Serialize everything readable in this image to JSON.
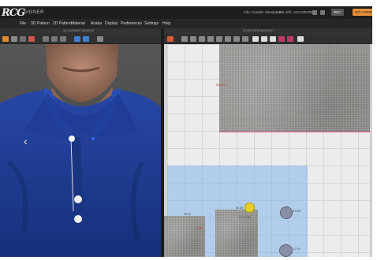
{
  "app": {
    "logo": "RCG",
    "logo_sub": "SIGNER"
  },
  "menubar": {
    "items": [
      "File",
      "3D Pattern",
      "2D Pattern",
      "Material",
      "Avatar",
      "Display",
      "Preferences",
      "Settings",
      "Help"
    ]
  },
  "titlebar_right": {
    "user_label": "Info: Cura08",
    "status_text": "Simulation",
    "zoom_text": "0.5 m/ft",
    "mode_text": "ACCURATE",
    "gray_button": "REC",
    "orange_button": "GO HOME"
  },
  "panels": {
    "left_title": "3D GARMENT WINDOW",
    "right_title": "2D PATTERN WINDOW"
  },
  "viewport3d": {
    "nav_arrow": "‹"
  },
  "pattern2d": {
    "labels": {
      "top_piece": "Fabric A",
      "bottom_left": "42.34",
      "bottom_mid": "46.34",
      "mid_size": "22.27CM",
      "small_num": "12.67",
      "circle_label_1": "9.0CM",
      "circle_label_2": "12.19"
    }
  },
  "colors": {
    "accent_orange": "#e8913a",
    "selection_blue": "#82b4eb",
    "shirt_blue": "#1f3d8c",
    "cursor_yellow": "#e8cc2a"
  }
}
